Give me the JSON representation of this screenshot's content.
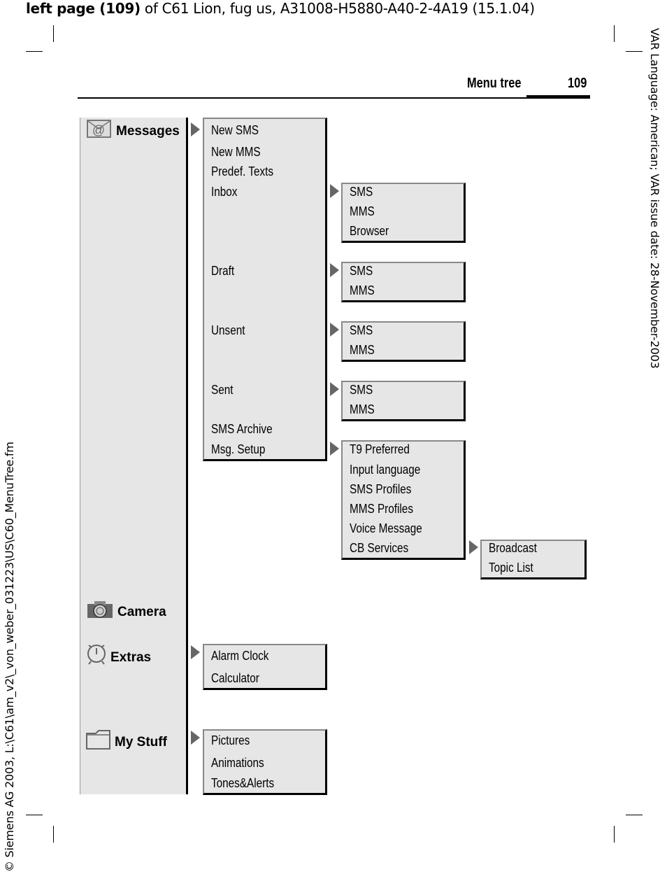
{
  "header": {
    "bold": "left page (109)",
    "rest": " of C61 Lion, fug us, A31008-H5880-A40-2-4A19 (15.1.04)"
  },
  "right_margin": "VAR Language: American; VAR issue date: 28-November-2003",
  "left_margin": "© Siemens AG 2003, L:\\C61\\am_v2\\_von_weber_031223\\US\\C60_MenuTree.fm",
  "running_title": "Menu tree",
  "page_number": "109",
  "main_menu": [
    {
      "label": "Messages",
      "icon": "envelope-at-icon"
    },
    {
      "label": "Camera",
      "icon": "camera-icon"
    },
    {
      "label": "Extras",
      "icon": "alarm-clock-icon"
    },
    {
      "label": "My Stuff",
      "icon": "folder-icon"
    }
  ],
  "messages": [
    "New SMS",
    "New MMS",
    "Predef. Texts",
    "Inbox",
    "Draft",
    "Unsent",
    "Sent",
    "SMS Archive",
    "Msg. Setup"
  ],
  "inbox": [
    "SMS",
    "MMS",
    "Browser"
  ],
  "draft": [
    "SMS",
    "MMS"
  ],
  "unsent": [
    "SMS",
    "MMS"
  ],
  "sent": [
    "SMS",
    "MMS"
  ],
  "msg_setup": [
    "T9 Preferred",
    "Input language",
    "SMS Profiles",
    "MMS Profiles",
    "Voice Message",
    "CB Services"
  ],
  "cb_services": [
    "Broadcast",
    "Topic List"
  ],
  "extras": [
    "Alarm Clock",
    "Calculator"
  ],
  "my_stuff": [
    "Pictures",
    "Animations",
    "Tones&Alerts"
  ]
}
